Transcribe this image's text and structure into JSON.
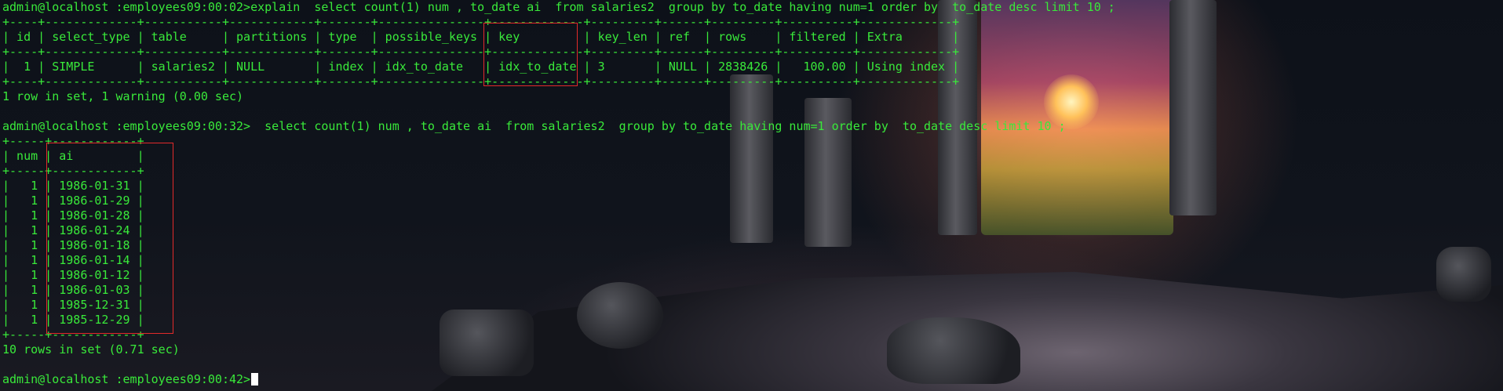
{
  "terminal": {
    "prompt_1": "admin@localhost :employees09:00:02>",
    "command_1": "explain  select count(1) num , to_date ai  from salaries2  group by to_date having num=1 order by  to_date desc limit 10 ;",
    "explain_border": "+----+-------------+-----------+------------+-------+---------------+-------------+---------+------+---------+----------+-------------+",
    "explain_header": "| id | select_type | table     | partitions | type  | possible_keys | key         | key_len | ref  | rows    | filtered | Extra       |",
    "explain_row": "|  1 | SIMPLE      | salaries2 | NULL       | index | idx_to_date   | idx_to_date | 3       | NULL | 2838426 |   100.00 | Using index |",
    "explain_status": "1 row in set, 1 warning (0.00 sec)",
    "prompt_2": "admin@localhost :employees09:00:32>",
    "command_2": "  select count(1) num , to_date ai  from salaries2  group by to_date having num=1 order by  to_date desc limit 10 ;",
    "result_border": "+-----+------------+",
    "result_header": "| num | ai         |",
    "result_rows": [
      "|   1 | 1986-01-31 |",
      "|   1 | 1986-01-29 |",
      "|   1 | 1986-01-28 |",
      "|   1 | 1986-01-24 |",
      "|   1 | 1986-01-18 |",
      "|   1 | 1986-01-14 |",
      "|   1 | 1986-01-12 |",
      "|   1 | 1986-01-03 |",
      "|   1 | 1985-12-31 |",
      "|   1 | 1985-12-29 |"
    ],
    "result_status": "10 rows in set (0.71 sec)",
    "prompt_3": "admin@localhost :employees09:00:42>"
  },
  "colors": {
    "text": "#39e93a",
    "highlight_box": "#e22a2a",
    "cursor": "#ffffff"
  }
}
